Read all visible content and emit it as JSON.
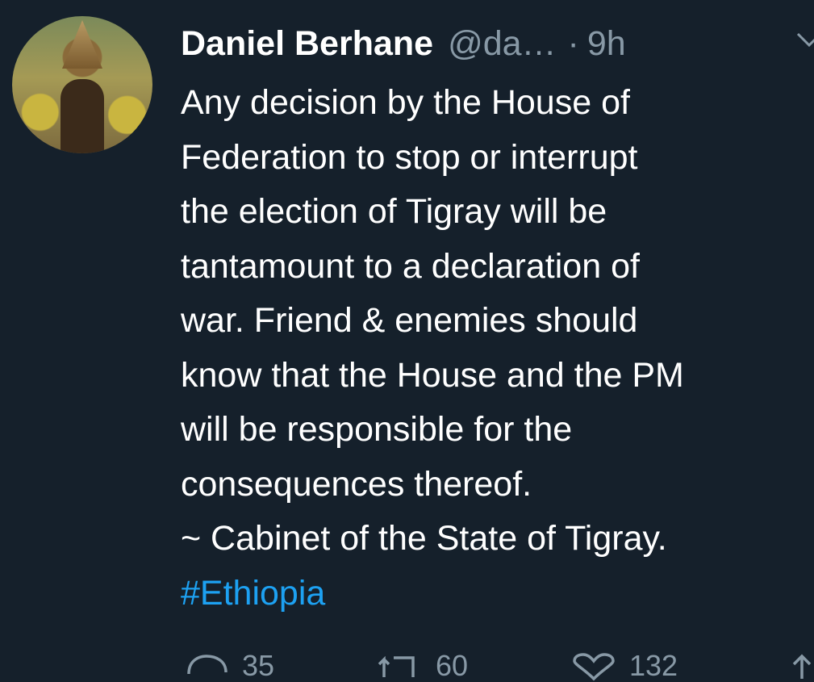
{
  "tweet": {
    "author_name": "Daniel Berhane",
    "author_handle": "@da…",
    "separator": "·",
    "time": "9h",
    "lines": [
      "Any decision by the House of",
      "Federation to stop or interrupt",
      "the election of Tigray will be",
      "tantamount to a declaration of",
      "war. Friend & enemies should",
      "know that the House and the PM",
      "will be responsible for the",
      "consequences thereof.",
      "~ Cabinet of the State of Tigray."
    ],
    "hashtag": "#Ethiopia"
  },
  "actions": {
    "replies": "35",
    "retweets": "60",
    "likes": "132"
  },
  "icons": [
    "avatar",
    "chevron-down-icon",
    "reply-icon",
    "retweet-icon",
    "like-icon",
    "share-icon"
  ],
  "colors": {
    "background": "#15202b",
    "text": "#ffffff",
    "muted": "#8899a6",
    "link": "#1da1f2"
  }
}
